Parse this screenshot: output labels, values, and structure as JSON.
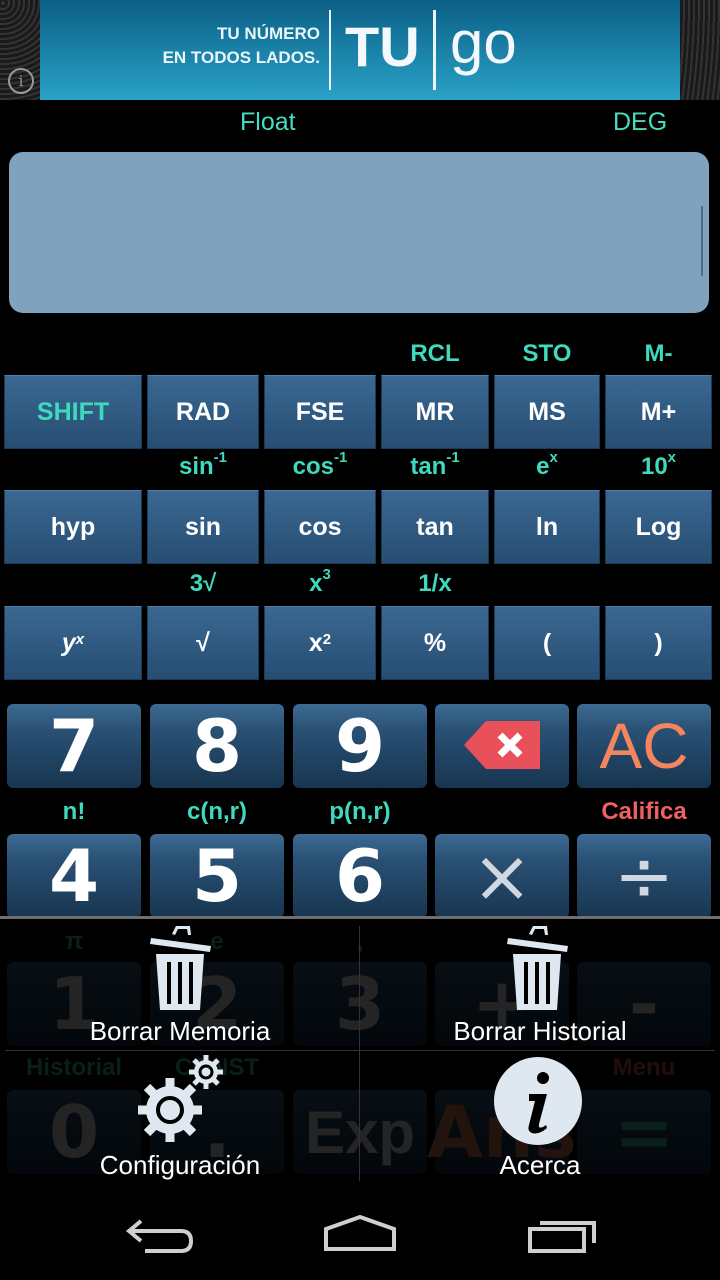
{
  "ad": {
    "line1": "TU NÚMERO",
    "line2": "EN TODOS LADOS.",
    "brand_tu": "TU",
    "brand_go": "go",
    "info_icon": "info-icon"
  },
  "status": {
    "format_mode": "Float",
    "angle_mode": "DEG"
  },
  "display": {
    "value": ""
  },
  "colors": {
    "accent_label": "#3fd9bd",
    "red_label": "#f06060",
    "key_blue": "#2a5175",
    "display_bg": "#7fa3be"
  },
  "sci_rows": [
    {
      "labels": [
        {
          "t": ""
        },
        {
          "t": ""
        },
        {
          "t": ""
        },
        {
          "t": "RCL"
        },
        {
          "t": "STO"
        },
        {
          "t": "M-"
        }
      ],
      "keys": [
        {
          "t": "SHIFT"
        },
        {
          "t": "RAD"
        },
        {
          "t": "FSE"
        },
        {
          "t": "MR"
        },
        {
          "t": "MS"
        },
        {
          "t": "M+"
        }
      ]
    },
    {
      "labels": [
        {
          "t": ""
        },
        {
          "t": "sin",
          "s": "-1"
        },
        {
          "t": "cos",
          "s": "-1"
        },
        {
          "t": "tan",
          "s": "-1"
        },
        {
          "t": "e",
          "s": "x"
        },
        {
          "t": "10",
          "s": "x"
        }
      ],
      "keys": [
        {
          "t": "hyp"
        },
        {
          "t": "sin"
        },
        {
          "t": "cos"
        },
        {
          "t": "tan"
        },
        {
          "t": "ln"
        },
        {
          "t": "Log"
        }
      ]
    },
    {
      "labels": [
        {
          "t": ""
        },
        {
          "t": "3√"
        },
        {
          "t": "x",
          "s": "3"
        },
        {
          "t": "1/x"
        },
        {
          "t": ""
        },
        {
          "t": ""
        }
      ],
      "keys": [
        {
          "t": "y",
          "s": "x"
        },
        {
          "t": "√"
        },
        {
          "t": "x",
          "s": "2"
        },
        {
          "t": "%"
        },
        {
          "t": "("
        },
        {
          "t": ")"
        }
      ]
    }
  ],
  "num_rows": [
    {
      "labels": [
        "",
        "",
        "",
        "",
        ""
      ],
      "keys": [
        "7",
        "8",
        "9",
        "⌫",
        "AC"
      ]
    },
    {
      "labels": [
        "n!",
        "c(n,r)",
        "p(n,r)",
        "",
        "Califica"
      ],
      "keys": [
        "4",
        "5",
        "6",
        "×",
        "÷"
      ]
    },
    {
      "labels": [
        "π",
        "e",
        ",",
        "",
        ""
      ],
      "keys": [
        "1",
        "2",
        "3",
        "+",
        "-"
      ]
    },
    {
      "labels": [
        "Historial",
        "CONST",
        "",
        "",
        "Menu"
      ],
      "keys": [
        "0",
        ".",
        "Exp",
        "Ans",
        "="
      ]
    }
  ],
  "menu": {
    "items": [
      {
        "label": "Borrar Memoria",
        "icon": "trash-icon"
      },
      {
        "label": "Borrar Historial",
        "icon": "trash-icon"
      },
      {
        "label": "Configuración",
        "icon": "gears-icon"
      },
      {
        "label": "Acerca",
        "icon": "info-icon"
      }
    ]
  },
  "navbar": {
    "back": "back-icon",
    "home": "home-icon",
    "recents": "recents-icon"
  }
}
